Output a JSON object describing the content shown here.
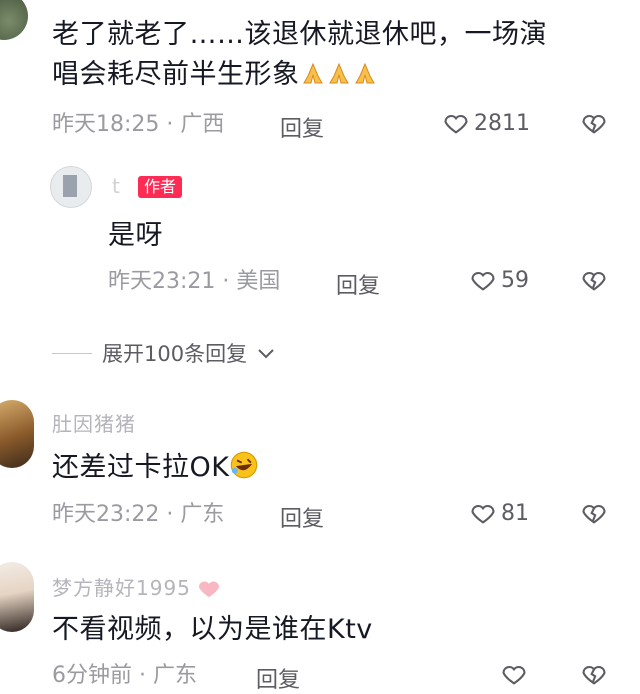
{
  "comments": [
    {
      "text_line1": "老了就老了……该退休就退休吧，一场演",
      "text_line2": "唱会耗尽前半生形象",
      "emoji": "folded-hands-x3",
      "time": "昨天18:25",
      "location": "广西",
      "reply_label": "回复",
      "likes": "2811"
    },
    {
      "author_badge": "作者",
      "author_name": "t",
      "text": "是呀",
      "time": "昨天23:21",
      "location": "美国",
      "reply_label": "回复",
      "likes": "59"
    },
    {
      "author_name": "肚因猪猪",
      "text": "还差过卡拉OK",
      "emoji": "rolling-on-floor-laughing",
      "time": "昨天23:22",
      "location": "广东",
      "reply_label": "回复",
      "likes": "81"
    },
    {
      "author_name": "梦方静好1995",
      "text": "不看视频，以为是谁在Ktv",
      "time": "6分钟前",
      "location": "广东",
      "reply_label": "回复",
      "likes": ""
    }
  ],
  "expand_replies": "展开100条回复",
  "separator": "·",
  "colors": {
    "badge": "#fe2c55",
    "meta": "#9a9ba0",
    "text": "#161823"
  }
}
